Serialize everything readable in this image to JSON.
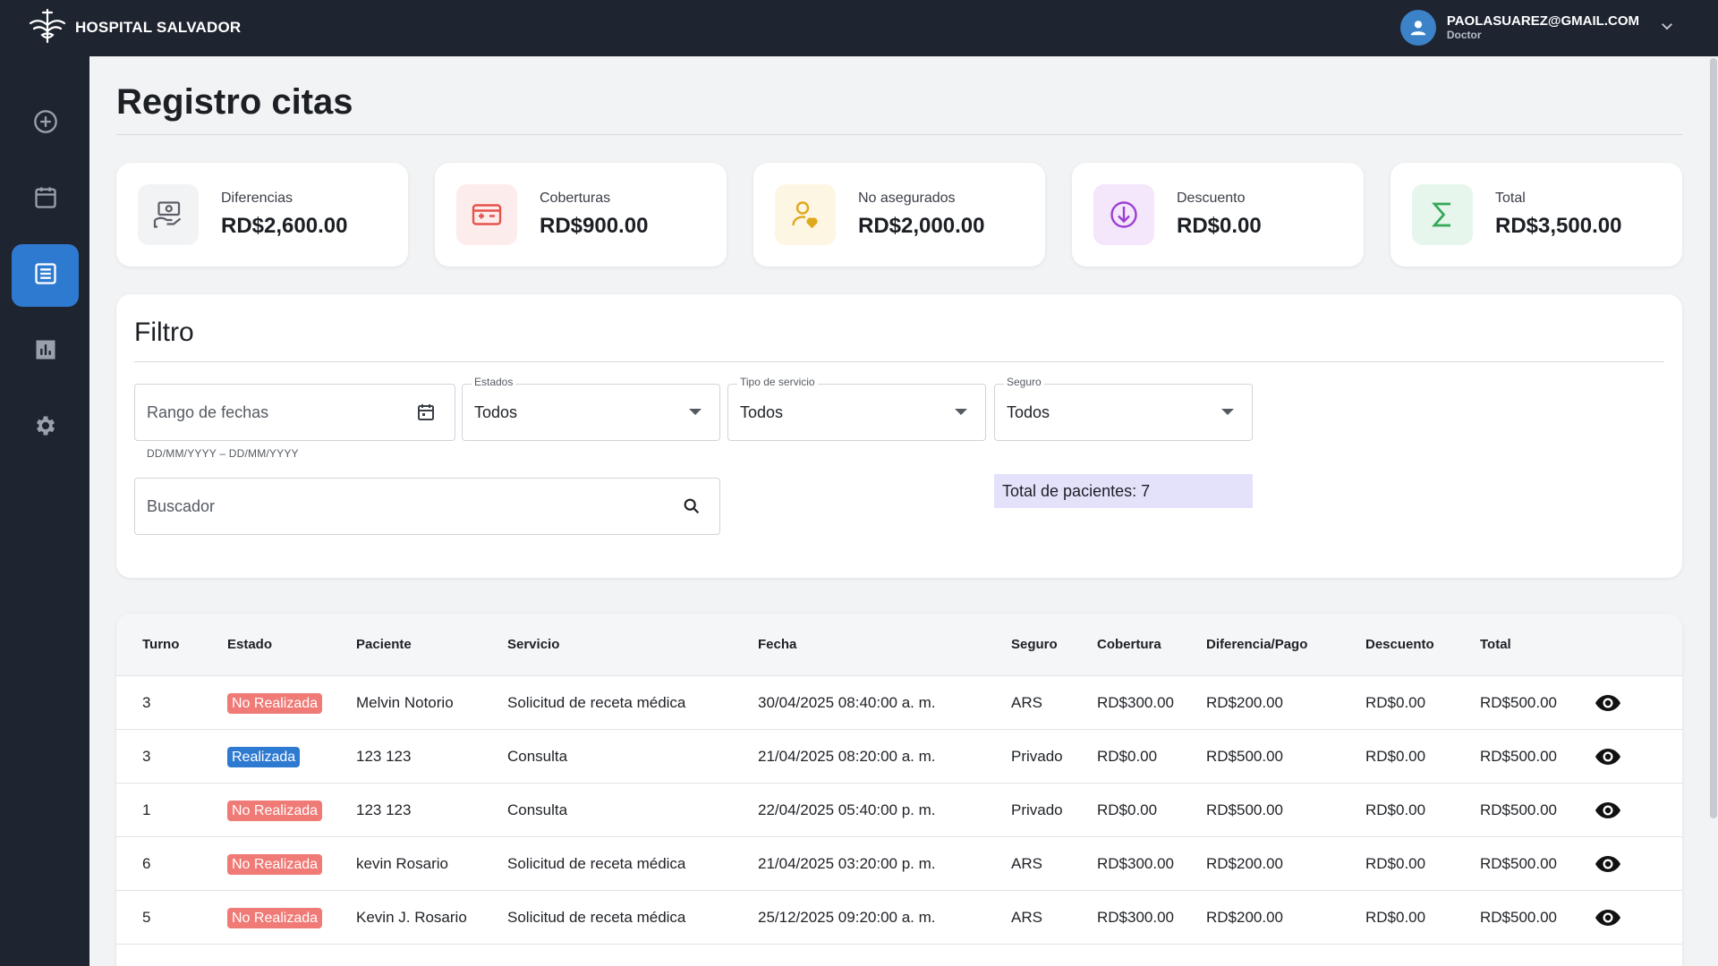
{
  "header": {
    "brand_name": "HOSPITAL SALVADOR",
    "user_email": "PAOLASUAREZ@GMAIL.COM",
    "user_role": "Doctor"
  },
  "sidebar": {
    "items": [
      {
        "icon": "add-circle-icon",
        "active": false
      },
      {
        "icon": "calendar-icon",
        "active": false
      },
      {
        "icon": "list-icon",
        "active": true
      },
      {
        "icon": "chart-icon",
        "active": false
      },
      {
        "icon": "gear-icon",
        "active": false
      }
    ]
  },
  "page": {
    "title": "Registro citas"
  },
  "summary": [
    {
      "label": "Diferencias",
      "value": "RD$2,600.00",
      "icon": "money-hand-icon",
      "tint": "#f2f3f5",
      "color": "#5b6068"
    },
    {
      "label": "Coberturas",
      "value": "RD$900.00",
      "icon": "card-plus-icon",
      "tint": "#fdecec",
      "color": "#e5534b"
    },
    {
      "label": "No asegurados",
      "value": "RD$2,000.00",
      "icon": "user-heart-icon",
      "tint": "#fdf6e3",
      "color": "#e0a81c"
    },
    {
      "label": "Descuento",
      "value": "RD$0.00",
      "icon": "discount-down-icon",
      "tint": "#f4e6fb",
      "color": "#9b3fd4"
    },
    {
      "label": "Total",
      "value": "RD$3,500.00",
      "icon": "sigma-icon",
      "tint": "#e6f6ec",
      "color": "#34a857"
    }
  ],
  "filter": {
    "title": "Filtro",
    "date_range_placeholder": "Rango de fechas",
    "date_range_helper": "DD/MM/YYYY – DD/MM/YYYY",
    "estados_label": "Estados",
    "estados_value": "Todos",
    "servicio_label": "Tipo de servicio",
    "servicio_value": "Todos",
    "seguro_label": "Seguro",
    "seguro_value": "Todos",
    "search_placeholder": "Buscador",
    "total_pacientes": "Total de pacientes: 7"
  },
  "table": {
    "columns": [
      "Turno",
      "Estado",
      "Paciente",
      "Servicio",
      "Fecha",
      "Seguro",
      "Cobertura",
      "Diferencia/Pago",
      "Descuento",
      "Total"
    ],
    "rows": [
      {
        "turno": "3",
        "estado": "No Realizada",
        "done": false,
        "paciente": "Melvin Notorio",
        "servicio": "Solicitud de receta médica",
        "fecha": "30/04/2025 08:40:00 a. m.",
        "seguro": "ARS",
        "cobertura": "RD$300.00",
        "diferencia": "RD$200.00",
        "descuento": "RD$0.00",
        "total": "RD$500.00"
      },
      {
        "turno": "3",
        "estado": "Realizada",
        "done": true,
        "paciente": "123 123",
        "servicio": "Consulta",
        "fecha": "21/04/2025 08:20:00 a. m.",
        "seguro": "Privado",
        "cobertura": "RD$0.00",
        "diferencia": "RD$500.00",
        "descuento": "RD$0.00",
        "total": "RD$500.00"
      },
      {
        "turno": "1",
        "estado": "No Realizada",
        "done": false,
        "paciente": "123 123",
        "servicio": "Consulta",
        "fecha": "22/04/2025 05:40:00 p. m.",
        "seguro": "Privado",
        "cobertura": "RD$0.00",
        "diferencia": "RD$500.00",
        "descuento": "RD$0.00",
        "total": "RD$500.00"
      },
      {
        "turno": "6",
        "estado": "No Realizada",
        "done": false,
        "paciente": "kevin Rosario",
        "servicio": "Solicitud de receta médica",
        "fecha": "21/04/2025 03:20:00 p. m.",
        "seguro": "ARS",
        "cobertura": "RD$300.00",
        "diferencia": "RD$200.00",
        "descuento": "RD$0.00",
        "total": "RD$500.00"
      },
      {
        "turno": "5",
        "estado": "No Realizada",
        "done": false,
        "paciente": "Kevin J. Rosario",
        "servicio": "Solicitud de receta médica",
        "fecha": "25/12/2025 09:20:00 a. m.",
        "seguro": "ARS",
        "cobertura": "RD$300.00",
        "diferencia": "RD$200.00",
        "descuento": "RD$0.00",
        "total": "RD$500.00"
      }
    ]
  }
}
